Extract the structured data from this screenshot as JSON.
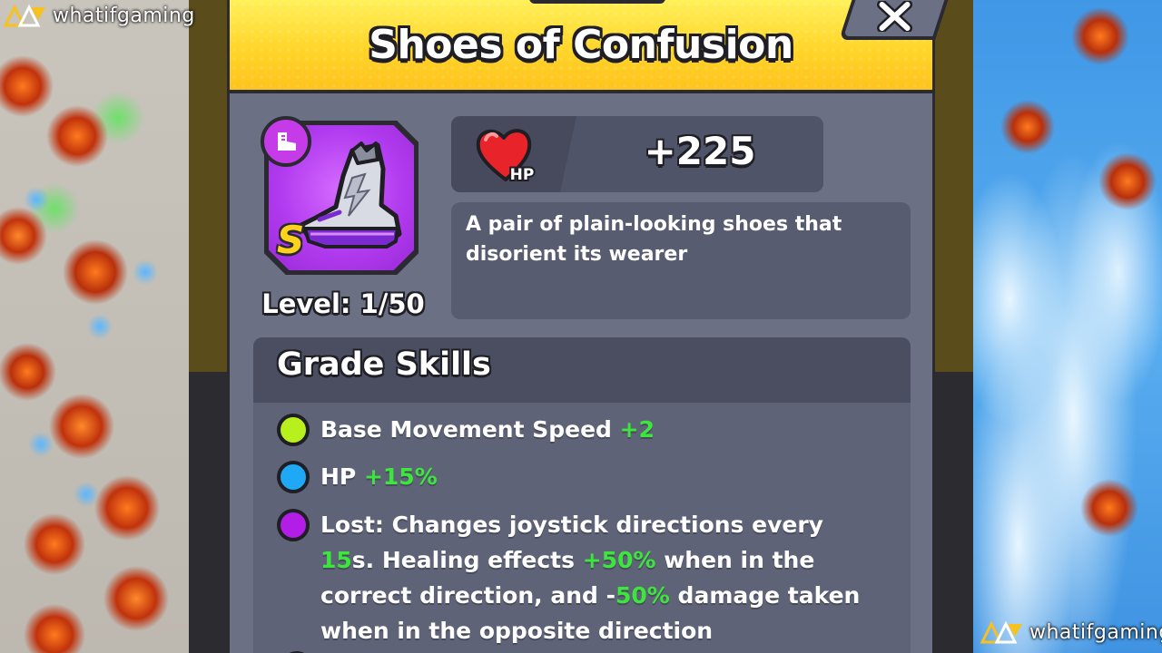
{
  "watermark": {
    "text": "whatifgaming"
  },
  "dialog": {
    "title": "Shoes of Confusion"
  },
  "item": {
    "icon": "boots-icon",
    "type_icon": "boot-mini-icon",
    "grade": "S",
    "level_text": "Level: 1/50",
    "colors": {
      "frame": "#b23cf0",
      "grade": "#ffd21e"
    }
  },
  "stat": {
    "icon": "heart-hp-icon",
    "icon_label": "HP",
    "value": "+225"
  },
  "description": "A pair of plain-looking shoes that disorient its wearer",
  "skills": {
    "title": "Grade Skills",
    "items": [
      {
        "dot_color": "#b8f01e",
        "parts": [
          {
            "text": "Base Movement Speed "
          },
          {
            "text": "+2",
            "highlight": true
          }
        ]
      },
      {
        "dot_color": "#1ea8f5",
        "parts": [
          {
            "text": "HP "
          },
          {
            "text": "+15%",
            "highlight": true
          }
        ]
      },
      {
        "dot_color": "#b21ee6",
        "parts": [
          {
            "text": "Lost: Changes joystick directions every "
          },
          {
            "text": "15",
            "highlight": true
          },
          {
            "text": "s. Healing effects "
          },
          {
            "text": "+50%",
            "highlight": true
          },
          {
            "text": " when in the correct direction, and -"
          },
          {
            "text": "50%",
            "highlight": true
          },
          {
            "text": " damage taken when in the opposite direction"
          }
        ]
      }
    ]
  },
  "colors": {
    "header_yellow": "#ffd52a",
    "card_bg": "#6b7084",
    "highlight_green": "#3de63d"
  }
}
